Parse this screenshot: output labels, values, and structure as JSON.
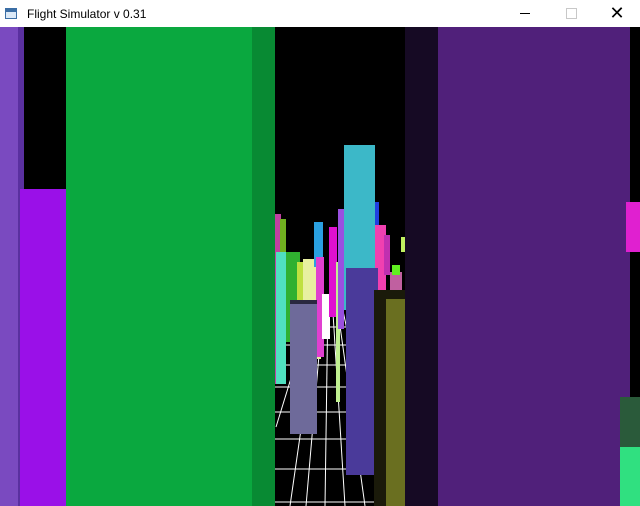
{
  "window": {
    "title": "Flight Simulator v 0.31",
    "icon": "app-window-icon",
    "controls": {
      "minimize_icon": "minimize-icon",
      "maximize_icon": "maximize-icon",
      "close_glyph": "✕"
    }
  },
  "scene": {
    "sky_color": "#000000",
    "ground_grid_color": "#ffffff",
    "building_colors": [
      "#0aa83f",
      "#50207a",
      "#9a10e8",
      "#7a4ac0",
      "#3cb8c8",
      "#4a3a9a",
      "#6a6f20",
      "#6e6a9a"
    ]
  }
}
